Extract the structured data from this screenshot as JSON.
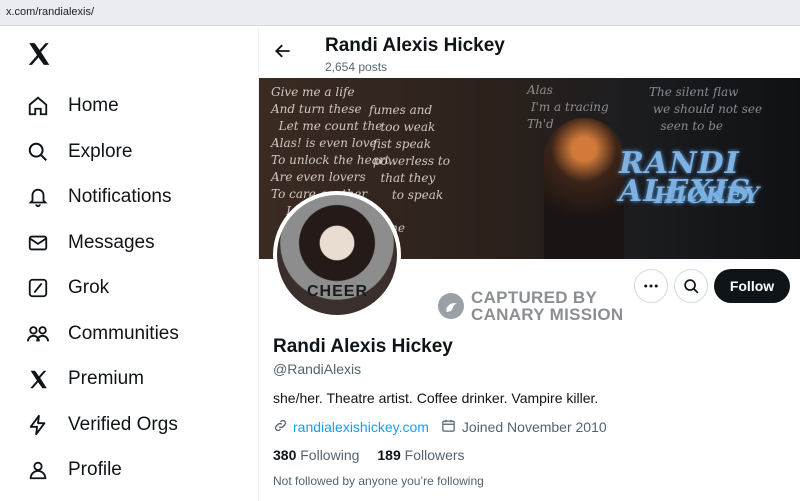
{
  "browser": {
    "url": "x.com/randialexis/"
  },
  "sidebar": {
    "logo_icon": "x-logo-icon",
    "items": [
      {
        "label": "Home",
        "icon": "home-icon"
      },
      {
        "label": "Explore",
        "icon": "search-icon"
      },
      {
        "label": "Notifications",
        "icon": "bell-icon"
      },
      {
        "label": "Messages",
        "icon": "envelope-icon"
      },
      {
        "label": "Grok",
        "icon": "grok-icon"
      },
      {
        "label": "Communities",
        "icon": "people-icon"
      },
      {
        "label": "Premium",
        "icon": "x-logo-icon"
      },
      {
        "label": "Verified Orgs",
        "icon": "lightning-icon"
      },
      {
        "label": "Profile",
        "icon": "person-icon"
      }
    ]
  },
  "header": {
    "name": "Randi Alexis Hickey",
    "posts": "2,654 posts"
  },
  "banner": {
    "logo_line1": "RANDI ALEXIS",
    "logo_line2": "HICKEY"
  },
  "avatar": {
    "shirt_text": "CHEER"
  },
  "actions": {
    "follow_label": "Follow"
  },
  "watermark": {
    "line1": "CAPTURED BY",
    "line2": "CANARY MISSION"
  },
  "profile": {
    "name": "Randi Alexis Hickey",
    "handle": "@RandiAlexis",
    "bio": "she/her. Theatre artist. Coffee drinker. Vampire killer.",
    "website": "randialexishickey.com",
    "joined": "Joined November 2010",
    "following_count": "380",
    "following_label": "Following",
    "followers_count": "189",
    "followers_label": "Followers",
    "followed_by": "Not followed by anyone you’re following"
  },
  "colors": {
    "accent": "#1d9bf0",
    "text": "#0f1419",
    "muted": "#536471",
    "follow_bg": "#0f1419"
  }
}
